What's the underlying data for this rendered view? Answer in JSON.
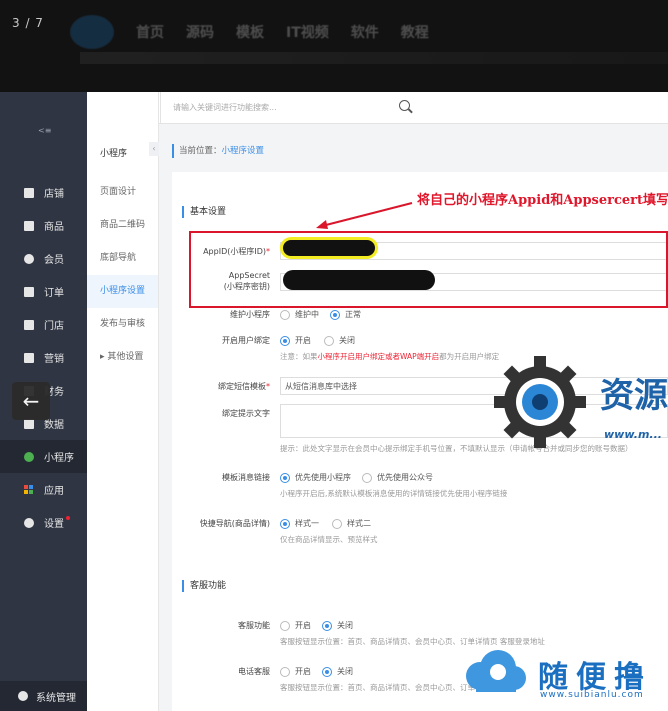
{
  "viewer": {
    "counter": "3 / 7"
  },
  "site_nav": {
    "items": [
      "首页",
      "源码",
      "模板",
      "IT视频",
      "软件",
      "教程"
    ]
  },
  "search": {
    "placeholder": "请输入关键词进行功能搜索..."
  },
  "sidebar": {
    "items": [
      {
        "label": "店铺",
        "icon": "store-icon"
      },
      {
        "label": "商品",
        "icon": "goods-icon"
      },
      {
        "label": "会员",
        "icon": "user-icon"
      },
      {
        "label": "订单",
        "icon": "order-icon"
      },
      {
        "label": "门店",
        "icon": "shop-icon"
      },
      {
        "label": "营销",
        "icon": "marketing-icon"
      },
      {
        "label": "财务",
        "icon": "finance-icon"
      },
      {
        "label": "数据",
        "icon": "data-icon"
      },
      {
        "label": "小程序",
        "icon": "miniprogram-icon"
      },
      {
        "label": "应用",
        "icon": "apps-icon"
      },
      {
        "label": "设置",
        "icon": "settings-icon"
      }
    ],
    "system": "系统管理"
  },
  "subnav": {
    "title": "小程序",
    "items": [
      "页面设计",
      "商品二维码",
      "底部导航",
      "小程序设置",
      "发布与审核",
      "其他设置"
    ]
  },
  "breadcrumb": {
    "prefix": "当前位置：",
    "current": "小程序设置"
  },
  "form": {
    "section_basic": "基本设置",
    "appid_label": "AppID(小程序ID)",
    "appsecret_label": "AppSecret",
    "appsecret_sub": "(小程序密钥)",
    "maint_label": "维护小程序",
    "maint_opt1": "维护中",
    "maint_opt2": "正常",
    "bind_label": "开启用户绑定",
    "bind_opt1": "开启",
    "bind_opt2": "关闭",
    "bind_note_pre": "注意：如果",
    "bind_note_red": "小程序开启用户绑定或者WAP端开启",
    "bind_note_post": "都为开启用户绑定",
    "sms_label": "绑定短信模板",
    "sms_value": "从短信消息库中选择",
    "tip_label": "绑定提示文字",
    "tip_note": "提示：此处文字显示在会员中心提示绑定手机号位置，不填默认显示（申请帐号合并或同步您的账号数据）",
    "msg_label": "模板消息链接",
    "msg_opt1": "优先使用小程序",
    "msg_opt2": "优先使用公众号",
    "msg_note": "小程序开启后,系统默认模板消息使用的详情链接优先使用小程序链接",
    "quick_label": "快捷导航(商品详情)",
    "quick_opt1": "样式一",
    "quick_opt2": "样式二",
    "quick_note": "仅在商品详情显示、预览样式",
    "section_service": "客服功能",
    "kf_label": "客服功能",
    "kf_opt1": "开启",
    "kf_opt2": "关闭",
    "kf_note": "客服按钮显示位置：首页、商品详情页、会员中心页、订单详情页 客服登录地址",
    "tel_label": "电话客服",
    "tel_opt1": "开启",
    "tel_opt2": "关闭",
    "tel_note": "客服按钮显示位置：首页、商品详情页、会员中心页、订单详情页"
  },
  "annotation": {
    "callout": "将自己的小程序Appid和Appsercert填写完",
    "color": "#d9162b"
  },
  "watermark1": {
    "text": "资源",
    "url": "www.m..."
  },
  "watermark2": {
    "text": "随便撸",
    "url": "www.suibianlu.com"
  },
  "colors": {
    "accent": "#3a8ee6",
    "sidebar": "#2f3542",
    "active_dot": "#4caf50"
  }
}
